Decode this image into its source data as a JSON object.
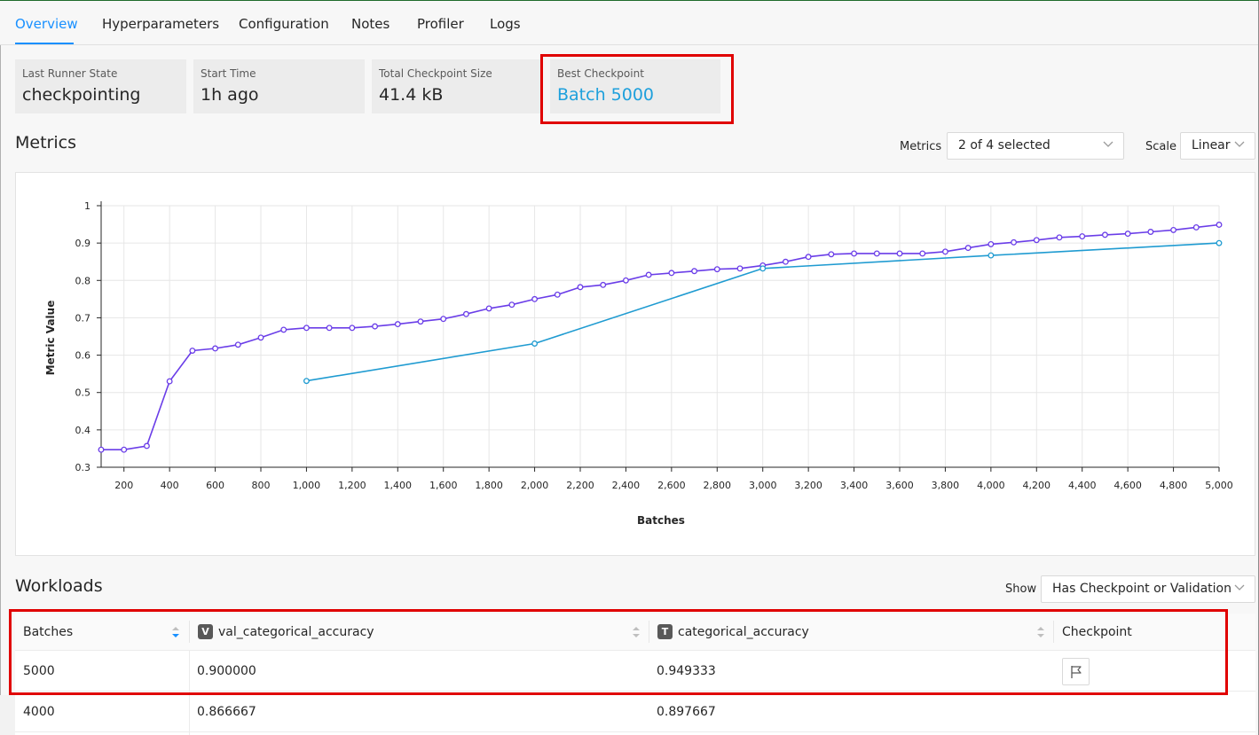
{
  "tabs": [
    {
      "label": "Overview",
      "active": true
    },
    {
      "label": "Hyperparameters"
    },
    {
      "label": "Configuration"
    },
    {
      "label": "Notes"
    },
    {
      "label": "Profiler"
    },
    {
      "label": "Logs"
    }
  ],
  "cards": [
    {
      "label": "Last Runner State",
      "value": "checkpointing"
    },
    {
      "label": "Start Time",
      "value": "1h ago"
    },
    {
      "label": "Total Checkpoint Size",
      "value": "41.4 kB"
    },
    {
      "label": "Best Checkpoint",
      "value": "Batch 5000"
    }
  ],
  "metrics_section": {
    "title": "Metrics",
    "metrics_label": "Metrics",
    "metrics_value": "2 of 4 selected",
    "scale_label": "Scale",
    "scale_value": "Linear"
  },
  "chart_data": {
    "type": "line",
    "xlabel": "Batches",
    "ylabel": "Metric Value",
    "xlim": [
      100,
      5000
    ],
    "ylim": [
      0.3,
      1
    ],
    "grid": true,
    "x_ticks": [
      "200",
      "400",
      "600",
      "800",
      "1,000",
      "1,200",
      "1,400",
      "1,600",
      "1,800",
      "2,000",
      "2,200",
      "2,400",
      "2,600",
      "2,800",
      "3,000",
      "3,200",
      "3,400",
      "3,600",
      "3,800",
      "4,000",
      "4,200",
      "4,400",
      "4,600",
      "4,800",
      "5,000"
    ],
    "y_ticks": [
      "0.3",
      "0.4",
      "0.5",
      "0.6",
      "0.7",
      "0.8",
      "0.9",
      "1"
    ],
    "series": [
      {
        "color": "#6a3de8",
        "x": [
          100,
          200,
          300,
          400,
          500,
          600,
          700,
          800,
          900,
          1000,
          1100,
          1200,
          1300,
          1400,
          1500,
          1600,
          1700,
          1800,
          1900,
          2000,
          2100,
          2200,
          2300,
          2400,
          2500,
          2600,
          2700,
          2800,
          2900,
          3000,
          3100,
          3200,
          3300,
          3400,
          3500,
          3600,
          3700,
          3800,
          3900,
          4000,
          4100,
          4200,
          4300,
          4400,
          4500,
          4600,
          4700,
          4800,
          4900,
          5000
        ],
        "y": [
          0.347,
          0.347,
          0.357,
          0.53,
          0.612,
          0.618,
          0.628,
          0.647,
          0.668,
          0.673,
          0.673,
          0.673,
          0.677,
          0.683,
          0.69,
          0.697,
          0.71,
          0.725,
          0.735,
          0.75,
          0.762,
          0.782,
          0.788,
          0.8,
          0.815,
          0.82,
          0.825,
          0.83,
          0.832,
          0.84,
          0.85,
          0.863,
          0.87,
          0.872,
          0.872,
          0.872,
          0.872,
          0.877,
          0.887,
          0.897,
          0.902,
          0.908,
          0.915,
          0.918,
          0.922,
          0.925,
          0.93,
          0.935,
          0.942,
          0.949
        ]
      },
      {
        "color": "#1f9bd1",
        "x": [
          1000,
          2000,
          3000,
          4000,
          5000
        ],
        "y": [
          0.531,
          0.631,
          0.832,
          0.867,
          0.9
        ]
      }
    ]
  },
  "workloads": {
    "title": "Workloads",
    "show_label": "Show",
    "show_value": "Has Checkpoint or Validation",
    "columns": [
      {
        "label": "Batches"
      },
      {
        "label": "val_categorical_accuracy",
        "badge": "V"
      },
      {
        "label": "categorical_accuracy",
        "badge": "T"
      },
      {
        "label": "Checkpoint"
      }
    ],
    "rows": [
      {
        "batches": "5000",
        "val": "0.900000",
        "train": "0.949333"
      },
      {
        "batches": "4000",
        "val": "0.866667",
        "train": "0.897667"
      }
    ]
  }
}
